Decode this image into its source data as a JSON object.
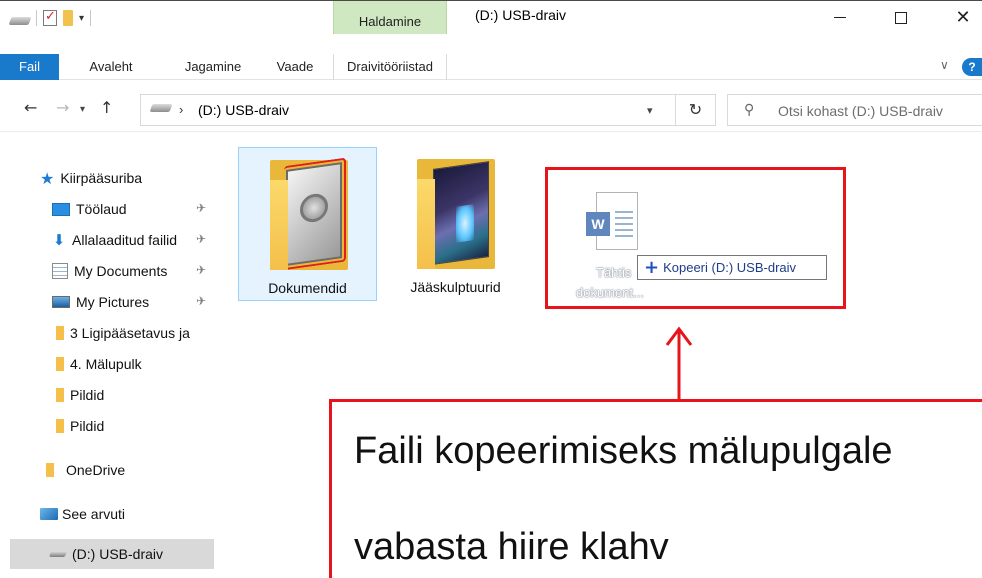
{
  "window": {
    "title": "(D:) USB-draiv",
    "context_tab_header": "Haldamine"
  },
  "ribbon": {
    "tabs": [
      "Fail",
      "Avaleht",
      "Jagamine",
      "Vaade",
      "Draivitööriistad"
    ]
  },
  "address_bar": {
    "path": "(D:) USB-draiv",
    "search_placeholder": "Otsi kohast (D:) USB-draiv"
  },
  "nav_pane": {
    "items": [
      {
        "label": "Kiirpääsuriba",
        "icon": "star-icon"
      },
      {
        "label": "Töölaud",
        "icon": "desktop-icon",
        "pinned": true
      },
      {
        "label": "Allalaaditud failid",
        "icon": "download-icon",
        "pinned": true
      },
      {
        "label": "My Documents",
        "icon": "documents-icon",
        "pinned": true
      },
      {
        "label": "My Pictures",
        "icon": "pictures-icon",
        "pinned": true
      },
      {
        "label": "3 Ligipääsetavus ja",
        "icon": "folder-icon"
      },
      {
        "label": "4. Mälupulk",
        "icon": "folder-icon"
      },
      {
        "label": "Pildid",
        "icon": "folder-icon"
      },
      {
        "label": "Pildid",
        "icon": "folder-icon"
      },
      {
        "label": "OneDrive",
        "icon": "folder-icon"
      },
      {
        "label": "See arvuti",
        "icon": "computer-icon"
      },
      {
        "label": "(D:) USB-draiv",
        "icon": "drive-icon",
        "selected": true
      }
    ]
  },
  "content": {
    "folders": [
      {
        "label": "Dokumendid"
      },
      {
        "label": "Jääskulptuurid"
      }
    ],
    "dragged_file": {
      "label_line1": "Tähtis",
      "label_line2": "dokument..."
    },
    "drop_tooltip": "Kopeeri (D:) USB-draiv"
  },
  "annotation": {
    "line1": "Faili kopeerimiseks mälupulgale",
    "line2": "vabasta hiire klahv"
  },
  "colors": {
    "accent": "#1979ca",
    "context_tab": "#cfe8c2",
    "annotation_red": "#e8141b",
    "selection": "#e5f3ff"
  }
}
